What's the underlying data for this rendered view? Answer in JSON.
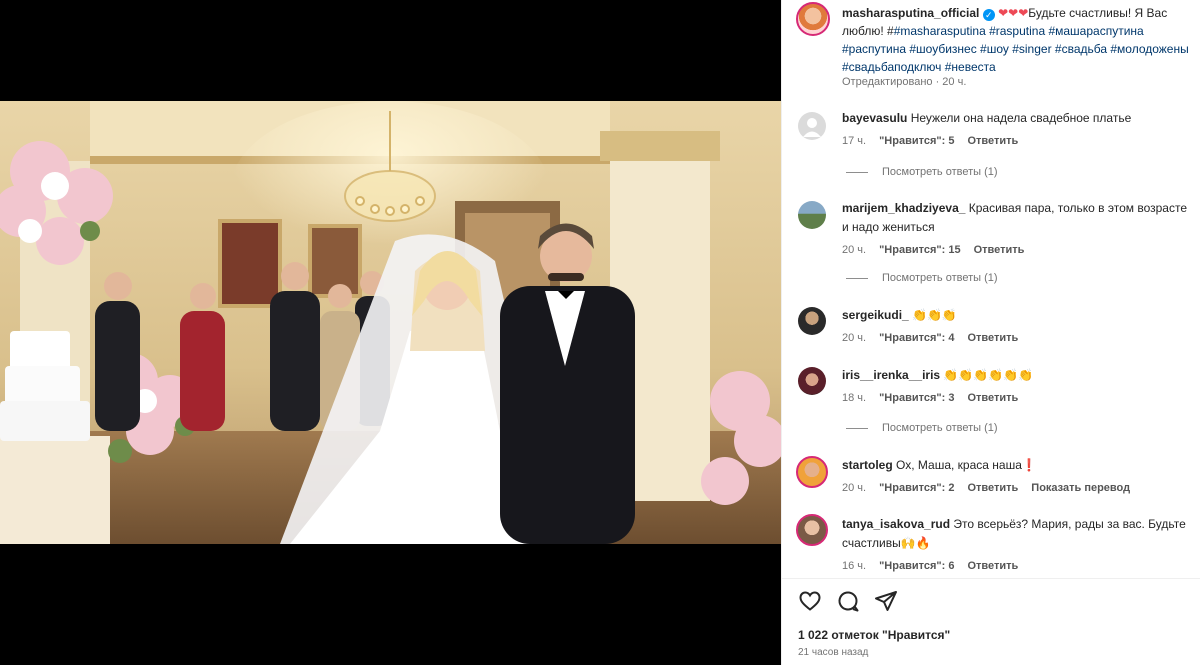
{
  "post": {
    "author": "masharasputina_official",
    "hearts": "❤❤❤",
    "caption_text": "Будьте счастливы! Я Вас люблю! #",
    "tags_line": "#masharasputina #rasputina #машараспутина #распутина #шоубизнес #шоу #singer #свадьба #молодожены #свадьбаподключ #невеста",
    "edited": "Отредактировано",
    "edited_time": "20 ч."
  },
  "comments": [
    {
      "user": "bayevasulu",
      "text": "Неужели она надела свадебное платье",
      "time": "17 ч.",
      "likes": "\"Нравится\": 5",
      "reply": "Ответить",
      "extra": "",
      "replies": "Посмотреть ответы (1)"
    },
    {
      "user": "marijem_khadziyeva_",
      "text": "Красивая пара, только в этом возрасте и надо жениться",
      "time": "20 ч.",
      "likes": "\"Нравится\": 15",
      "reply": "Ответить",
      "extra": "",
      "replies": "Посмотреть ответы (1)"
    },
    {
      "user": "sergeikudi_",
      "text": "👏👏👏",
      "time": "20 ч.",
      "likes": "\"Нравится\": 4",
      "reply": "Ответить",
      "extra": "",
      "replies": ""
    },
    {
      "user": "iris__irenka__iris",
      "text": "👏👏👏👏👏👏",
      "time": "18 ч.",
      "likes": "\"Нравится\": 3",
      "reply": "Ответить",
      "extra": "",
      "replies": "Посмотреть ответы (1)"
    },
    {
      "user": "startoleg",
      "text": "Ох, Маша, краса наша❗",
      "time": "20 ч.",
      "likes": "\"Нравится\": 2",
      "reply": "Ответить",
      "extra": "Показать перевод",
      "replies": ""
    },
    {
      "user": "tanya_isakova_rud",
      "text": "Это всерьёз? Мария, рады за вас. Будьте счастливы🙌🔥",
      "time": "16 ч.",
      "likes": "\"Нравится\": 6",
      "reply": "Ответить",
      "extra": "",
      "replies": ""
    }
  ],
  "footer": {
    "likes": "1 022 отметок \"Нравится\"",
    "time": "21 часов назад"
  },
  "icons": {
    "like": "heart-icon",
    "comment": "comment-icon",
    "share": "paper-plane-icon",
    "verified": "verified-badge-icon"
  },
  "colors": {
    "link": "#00376b",
    "verified": "#0095f6",
    "heart": "#ed4956"
  }
}
